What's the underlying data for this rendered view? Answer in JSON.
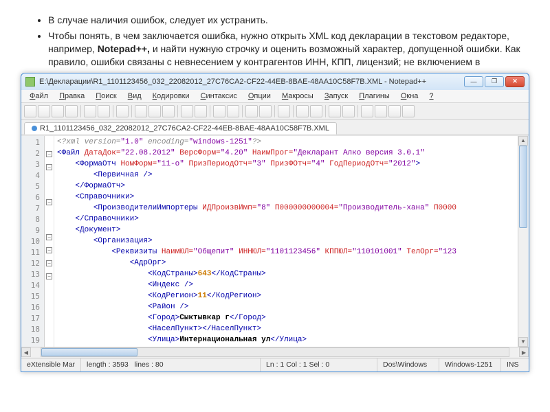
{
  "bullets": [
    "В случае наличия ошибок, следует их устранить.",
    "Чтобы понять, в чем заключается ошибка, нужно открыть XML код декларации в текстовом редакторе, например, Notepad++, и найти нужную строчку и оценить возможный характер, допущенной ошибки. Как правило, ошибки связаны с невнесением у контрагентов ИНН, КПП, лицензий; не включением в"
  ],
  "window": {
    "title": "E:\\Декларации\\R1_1101123456_032_22082012_27C76CA2-CF22-44EB-8BAE-48AA10C58F7B.XML - Notepad++"
  },
  "menu": [
    "Файл",
    "Правка",
    "Поиск",
    "Вид",
    "Кодировки",
    "Синтаксис",
    "Опции",
    "Макросы",
    "Запуск",
    "Плагины",
    "Окна",
    "?"
  ],
  "tab": {
    "label": "R1_1101123456_032_22082012_27C76CA2-CF22-44EB-8BAE-48AA10C58F7B.XML"
  },
  "lines": [
    {
      "n": 1,
      "indent": 0,
      "html": "<span class='decl'>&lt;?xml version=</span><span class='val'>\"1.0\"</span><span class='decl'> encoding=</span><span class='val'>\"windows-1251\"</span><span class='decl'>?&gt;</span>"
    },
    {
      "n": 2,
      "indent": 0,
      "html": "<span class='kw'>&lt;Файл</span> <span class='attr'>ДатаДок=</span><span class='val'>\"22.08.2012\"</span> <span class='attr'>ВерсФорм=</span><span class='val'>\"4.20\"</span> <span class='attr'>НаимПрог=</span><span class='val'>\"Декларант Алко версия 3.0.1\"</span>"
    },
    {
      "n": 3,
      "indent": 1,
      "html": "<span class='kw'>&lt;ФормаОтч</span> <span class='attr'>НомФорм=</span><span class='val'>\"11-о\"</span> <span class='attr'>ПризПериодОтч=</span><span class='val'>\"3\"</span> <span class='attr'>ПризФОтч=</span><span class='val'>\"4\"</span> <span class='attr'>ГодПериодОтч=</span><span class='val'>\"2012\"</span><span class='kw'>&gt;</span>"
    },
    {
      "n": 4,
      "indent": 2,
      "html": "<span class='kw'>&lt;Первичная /&gt;</span>"
    },
    {
      "n": 5,
      "indent": 1,
      "html": "<span class='kw'>&lt;/ФормаОтч&gt;</span>"
    },
    {
      "n": 6,
      "indent": 1,
      "html": "<span class='kw'>&lt;Справочники&gt;</span>"
    },
    {
      "n": 7,
      "indent": 2,
      "html": "<span class='kw'>&lt;ПроизводителиИмпортеры</span> <span class='attr'>ИДПроизвИмп=</span><span class='val'>\"8\"</span> <span class='attr'>П000000000004=</span><span class='val'>\"Производитель-хана\"</span> <span class='attr'>П0000</span>"
    },
    {
      "n": 8,
      "indent": 1,
      "html": "<span class='kw'>&lt;/Справочники&gt;</span>"
    },
    {
      "n": 9,
      "indent": 1,
      "html": "<span class='kw'>&lt;Документ&gt;</span>"
    },
    {
      "n": 10,
      "indent": 2,
      "html": "<span class='kw'>&lt;Организация&gt;</span>"
    },
    {
      "n": 11,
      "indent": 3,
      "html": "<span class='kw'>&lt;Реквизиты</span> <span class='attr'>НаимЮЛ=</span><span class='val'>\"Общепит\"</span> <span class='attr'>ИННЮЛ=</span><span class='val'>\"1101123456\"</span> <span class='attr'>КППЮЛ=</span><span class='val'>\"110101001\"</span> <span class='attr'>ТелОрг=</span><span class='val'>\"123</span>"
    },
    {
      "n": 12,
      "indent": 4,
      "html": "<span class='kw'>&lt;АдрОрг&gt;</span>"
    },
    {
      "n": 13,
      "indent": 5,
      "html": "<span class='kw'>&lt;КодСтраны&gt;</span><span class='num'>643</span><span class='kw'>&lt;/КодСтраны&gt;</span>"
    },
    {
      "n": 14,
      "indent": 5,
      "html": "<span class='kw'>&lt;Индекс /&gt;</span>"
    },
    {
      "n": 15,
      "indent": 5,
      "html": "<span class='kw'>&lt;КодРегион&gt;</span><span class='num'>11</span><span class='kw'>&lt;/КодРегион&gt;</span>"
    },
    {
      "n": 16,
      "indent": 5,
      "html": "<span class='kw'>&lt;Район /&gt;</span>"
    },
    {
      "n": 17,
      "indent": 5,
      "html": "<span class='kw'>&lt;Город&gt;</span><span class='txt'>Сыктывкар г</span><span class='kw'>&lt;/Город&gt;</span>"
    },
    {
      "n": 18,
      "indent": 5,
      "html": "<span class='kw'>&lt;НаселПункт&gt;</span><span class='kw'>&lt;/НаселПункт&gt;</span>"
    },
    {
      "n": 19,
      "indent": 5,
      "html": "<span class='kw'>&lt;Улица&gt;</span><span class='txt'>Интернациональная ул</span><span class='kw'>&lt;/Улица&gt;</span>"
    }
  ],
  "status": {
    "lang": "eXtensible Mar",
    "length": "length : 3593",
    "lines_count": "lines : 80",
    "pos": "Ln : 1    Col : 1    Sel : 0",
    "eol": "Dos\\Windows",
    "enc": "Windows-1251",
    "mode": "INS"
  },
  "toolbar_icons": [
    "new",
    "open",
    "save",
    "save-all",
    "|",
    "close",
    "close-all",
    "|",
    "print",
    "|",
    "cut",
    "copy",
    "paste",
    "|",
    "undo",
    "redo",
    "|",
    "find",
    "replace",
    "|",
    "zoom-in",
    "zoom-out",
    "|",
    "wrap",
    "|",
    "ws",
    "indent",
    "|",
    "fold",
    "unfold",
    "|",
    "macro-rec",
    "macro-play",
    "macro-stop",
    "macro-run"
  ],
  "fold_markers": [
    "",
    "-",
    "-",
    "",
    "",
    "-",
    "",
    "",
    "-",
    "-",
    "-",
    "-",
    "",
    "",
    "",
    "",
    "",
    "",
    ""
  ]
}
